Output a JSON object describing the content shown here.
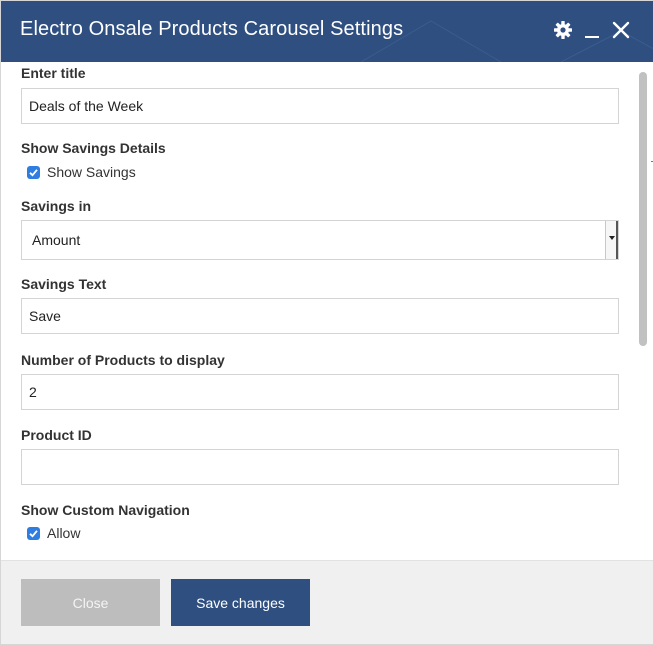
{
  "dialog": {
    "title": "Electro Onsale Products Carousel Settings",
    "header_color": "#2e4f80",
    "icons": [
      "gear-icon",
      "minimize-icon",
      "close-icon"
    ]
  },
  "form": {
    "title_label": "Enter title",
    "title_value": "Deals of the Week",
    "savings_details_label": "Show Savings Details",
    "show_savings_label": "Show Savings",
    "show_savings_checked": true,
    "savings_in_label": "Savings in",
    "savings_in_value": "Amount",
    "savings_text_label": "Savings Text",
    "savings_text_value": "Save",
    "num_products_label": "Number of Products to display",
    "num_products_value": "2",
    "product_id_label": "Product ID",
    "product_id_value": "",
    "custom_nav_label": "Show Custom Navigation",
    "allow_label": "Allow",
    "allow_checked": true
  },
  "footer": {
    "close_label": "Close",
    "save_label": "Save changes"
  }
}
